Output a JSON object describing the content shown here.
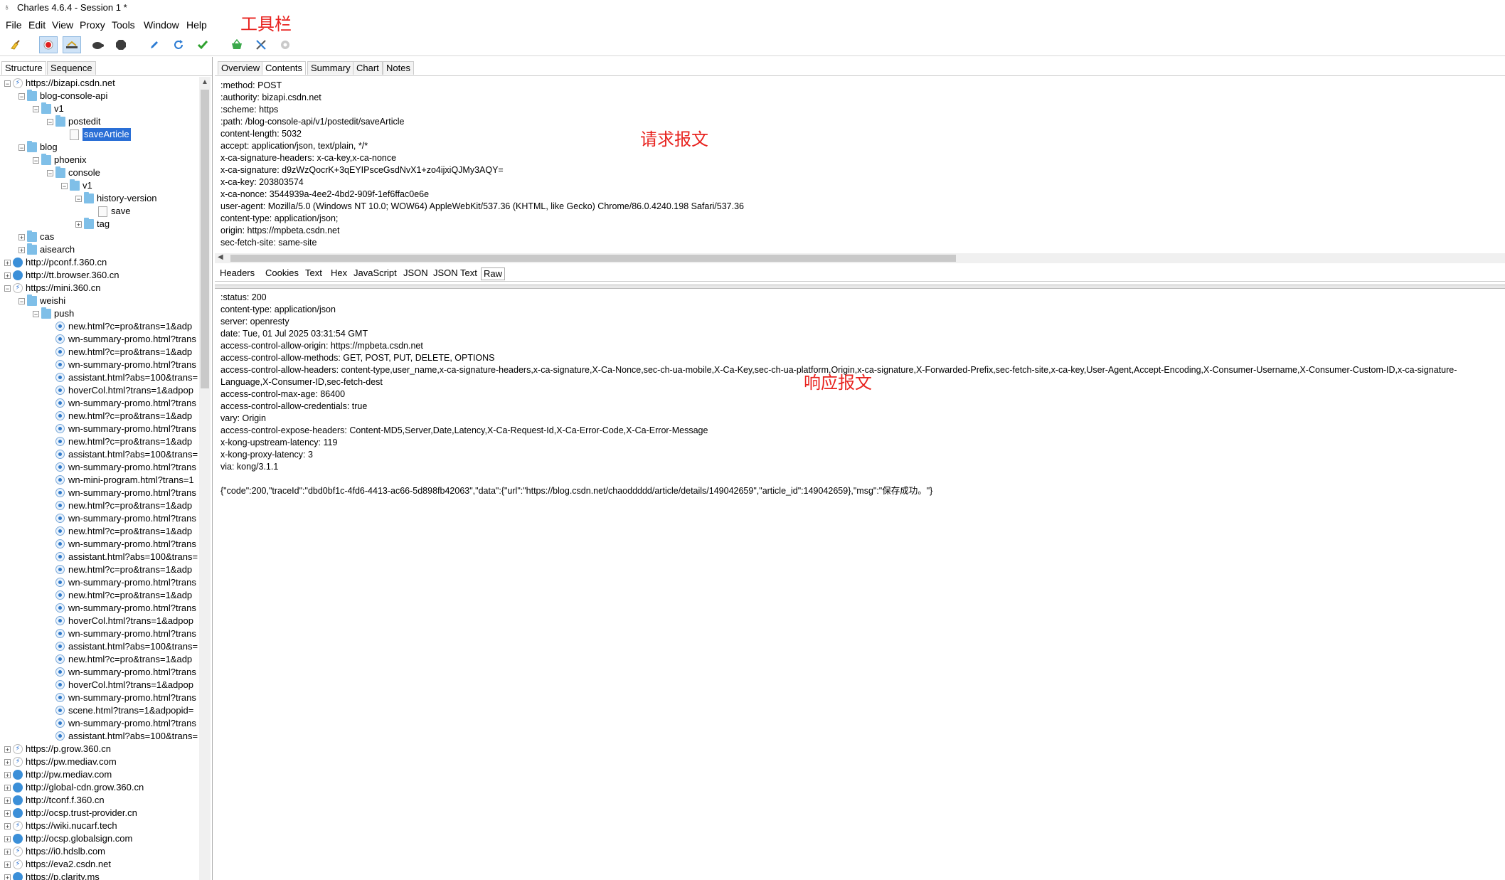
{
  "window": {
    "title": "Charles 4.6.4 - Session 1 *"
  },
  "menu": [
    "File",
    "Edit",
    "View",
    "Proxy",
    "Tools",
    "Window",
    "Help"
  ],
  "toolbar_annotation": "工具栏",
  "request_annotation": "请求报文",
  "response_annotation": "响应报文",
  "toolbar": {
    "icons": [
      "broom-icon",
      "record-icon",
      "throttle-icon",
      "turtle-icon",
      "stop-icon",
      "pen-icon",
      "refresh-icon",
      "check-icon",
      "basket-icon",
      "tools-icon",
      "settings-icon"
    ],
    "colors": {
      "record": "#e02020",
      "check": "#2fa12f",
      "basket": "#3aa84a",
      "refresh": "#2b7bd3"
    }
  },
  "left_tabs": [
    "Structure",
    "Sequence"
  ],
  "tree": [
    {
      "label": "https://bizapi.csdn.net",
      "icon": "lightning",
      "exp": "−",
      "level": 0
    },
    {
      "label": "blog-console-api",
      "icon": "folder",
      "exp": "−",
      "level": 1
    },
    {
      "label": "v1",
      "icon": "folder",
      "exp": "−",
      "level": 2
    },
    {
      "label": "postedit",
      "icon": "folder",
      "exp": "−",
      "level": 3
    },
    {
      "label": "saveArticle",
      "icon": "page",
      "exp": "",
      "level": 4,
      "selected": true
    },
    {
      "label": "blog",
      "icon": "folder",
      "exp": "−",
      "level": 1
    },
    {
      "label": "phoenix",
      "icon": "folder",
      "exp": "−",
      "level": 2
    },
    {
      "label": "console",
      "icon": "folder",
      "exp": "−",
      "level": 3
    },
    {
      "label": "v1",
      "icon": "folder",
      "exp": "−",
      "level": 4
    },
    {
      "label": "history-version",
      "icon": "folder",
      "exp": "−",
      "level": 5
    },
    {
      "label": "save",
      "icon": "page",
      "exp": "",
      "level": 6
    },
    {
      "label": "tag",
      "icon": "folder",
      "exp": "+",
      "level": 5
    },
    {
      "label": "cas",
      "icon": "folder",
      "exp": "+",
      "level": 1
    },
    {
      "label": "aisearch",
      "icon": "folder",
      "exp": "+",
      "level": 1
    },
    {
      "label": "http://pconf.f.360.cn",
      "icon": "globe",
      "exp": "+",
      "level": 0
    },
    {
      "label": "http://tt.browser.360.cn",
      "icon": "globe",
      "exp": "+",
      "level": 0
    },
    {
      "label": "https://mini.360.cn",
      "icon": "lightning",
      "exp": "−",
      "level": 0
    },
    {
      "label": "weishi",
      "icon": "folder",
      "exp": "−",
      "level": 1
    },
    {
      "label": "push",
      "icon": "folder",
      "exp": "−",
      "level": 2
    },
    {
      "label": "new.html?c=pro&trans=1&adp",
      "icon": "dot",
      "exp": "",
      "level": 3
    },
    {
      "label": "wn-summary-promo.html?trans",
      "icon": "dot",
      "exp": "",
      "level": 3
    },
    {
      "label": "new.html?c=pro&trans=1&adp",
      "icon": "dot",
      "exp": "",
      "level": 3
    },
    {
      "label": "wn-summary-promo.html?trans",
      "icon": "dot",
      "exp": "",
      "level": 3
    },
    {
      "label": "assistant.html?abs=100&trans=",
      "icon": "dot",
      "exp": "",
      "level": 3
    },
    {
      "label": "hoverCol.html?trans=1&adpop",
      "icon": "dot",
      "exp": "",
      "level": 3
    },
    {
      "label": "wn-summary-promo.html?trans",
      "icon": "dot",
      "exp": "",
      "level": 3
    },
    {
      "label": "new.html?c=pro&trans=1&adp",
      "icon": "dot",
      "exp": "",
      "level": 3
    },
    {
      "label": "wn-summary-promo.html?trans",
      "icon": "dot",
      "exp": "",
      "level": 3
    },
    {
      "label": "new.html?c=pro&trans=1&adp",
      "icon": "dot",
      "exp": "",
      "level": 3
    },
    {
      "label": "assistant.html?abs=100&trans=",
      "icon": "dot",
      "exp": "",
      "level": 3
    },
    {
      "label": "wn-summary-promo.html?trans",
      "icon": "dot",
      "exp": "",
      "level": 3
    },
    {
      "label": "wn-mini-program.html?trans=1",
      "icon": "dot",
      "exp": "",
      "level": 3
    },
    {
      "label": "wn-summary-promo.html?trans",
      "icon": "dot",
      "exp": "",
      "level": 3
    },
    {
      "label": "new.html?c=pro&trans=1&adp",
      "icon": "dot",
      "exp": "",
      "level": 3
    },
    {
      "label": "wn-summary-promo.html?trans",
      "icon": "dot",
      "exp": "",
      "level": 3
    },
    {
      "label": "new.html?c=pro&trans=1&adp",
      "icon": "dot",
      "exp": "",
      "level": 3
    },
    {
      "label": "wn-summary-promo.html?trans",
      "icon": "dot",
      "exp": "",
      "level": 3
    },
    {
      "label": "assistant.html?abs=100&trans=",
      "icon": "dot",
      "exp": "",
      "level": 3
    },
    {
      "label": "new.html?c=pro&trans=1&adp",
      "icon": "dot",
      "exp": "",
      "level": 3
    },
    {
      "label": "wn-summary-promo.html?trans",
      "icon": "dot",
      "exp": "",
      "level": 3
    },
    {
      "label": "new.html?c=pro&trans=1&adp",
      "icon": "dot",
      "exp": "",
      "level": 3
    },
    {
      "label": "wn-summary-promo.html?trans",
      "icon": "dot",
      "exp": "",
      "level": 3
    },
    {
      "label": "hoverCol.html?trans=1&adpop",
      "icon": "dot",
      "exp": "",
      "level": 3
    },
    {
      "label": "wn-summary-promo.html?trans",
      "icon": "dot",
      "exp": "",
      "level": 3
    },
    {
      "label": "assistant.html?abs=100&trans=",
      "icon": "dot",
      "exp": "",
      "level": 3
    },
    {
      "label": "new.html?c=pro&trans=1&adp",
      "icon": "dot",
      "exp": "",
      "level": 3
    },
    {
      "label": "wn-summary-promo.html?trans",
      "icon": "dot",
      "exp": "",
      "level": 3
    },
    {
      "label": "hoverCol.html?trans=1&adpop",
      "icon": "dot",
      "exp": "",
      "level": 3
    },
    {
      "label": "wn-summary-promo.html?trans",
      "icon": "dot",
      "exp": "",
      "level": 3
    },
    {
      "label": "scene.html?trans=1&adpopid=",
      "icon": "dot",
      "exp": "",
      "level": 3
    },
    {
      "label": "wn-summary-promo.html?trans",
      "icon": "dot",
      "exp": "",
      "level": 3
    },
    {
      "label": "assistant.html?abs=100&trans=",
      "icon": "dot",
      "exp": "",
      "level": 3
    },
    {
      "label": "https://p.grow.360.cn",
      "icon": "lightning",
      "exp": "+",
      "level": 0
    },
    {
      "label": "https://pw.mediav.com",
      "icon": "lightning",
      "exp": "+",
      "level": 0
    },
    {
      "label": "http://pw.mediav.com",
      "icon": "globe",
      "exp": "+",
      "level": 0
    },
    {
      "label": "http://global-cdn.grow.360.cn",
      "icon": "globe",
      "exp": "+",
      "level": 0
    },
    {
      "label": "http://tconf.f.360.cn",
      "icon": "globe",
      "exp": "+",
      "level": 0
    },
    {
      "label": "http://ocsp.trust-provider.cn",
      "icon": "globe",
      "exp": "+",
      "level": 0
    },
    {
      "label": "https://wiki.nucarf.tech",
      "icon": "lightning",
      "exp": "+",
      "level": 0
    },
    {
      "label": "http://ocsp.globalsign.com",
      "icon": "globe",
      "exp": "+",
      "level": 0
    },
    {
      "label": "https://i0.hdslb.com",
      "icon": "lightning",
      "exp": "+",
      "level": 0
    },
    {
      "label": "https://eva2.csdn.net",
      "icon": "lightning",
      "exp": "+",
      "level": 0
    },
    {
      "label": "https://p.clarity.ms",
      "icon": "globe",
      "exp": "+",
      "level": 0
    }
  ],
  "right_tabs": [
    "Overview",
    "Contents",
    "Summary",
    "Chart",
    "Notes"
  ],
  "right_tabs_selected": "Contents",
  "request_lines": [
    ":method: POST",
    ":authority: bizapi.csdn.net",
    ":scheme: https",
    ":path: /blog-console-api/v1/postedit/saveArticle",
    "content-length: 5032",
    "accept: application/json, text/plain, */*",
    "x-ca-signature-headers: x-ca-key,x-ca-nonce",
    "x-ca-signature: d9zWzQocrK+3qEYIPsceGsdNvX1+zo4ijxiQJMy3AQY=",
    "x-ca-key: 203803574",
    "x-ca-nonce: 3544939a-4ee2-4bd2-909f-1ef6ffac0e6e",
    "user-agent: Mozilla/5.0 (Windows NT 10.0; WOW64) AppleWebKit/537.36 (KHTML, like Gecko) Chrome/86.0.4240.198 Safari/537.36",
    "content-type: application/json;",
    "origin: https://mpbeta.csdn.net",
    "sec-fetch-site: same-site"
  ],
  "bottom_tabs": [
    "Headers",
    "Cookies",
    "Text",
    "Hex",
    "JavaScript",
    "JSON",
    "JSON Text",
    "Raw"
  ],
  "bottom_tabs_selected": "Raw",
  "response_lines": [
    ":status: 200",
    "content-type: application/json",
    "server: openresty",
    "date: Tue, 01 Jul 2025 03:31:54 GMT",
    "access-control-allow-origin: https://mpbeta.csdn.net",
    "access-control-allow-methods: GET, POST, PUT, DELETE, OPTIONS",
    "access-control-allow-headers: content-type,user_name,x-ca-signature-headers,x-ca-signature,X-Ca-Nonce,sec-ch-ua-mobile,X-Ca-Key,sec-ch-ua-platform,Origin,x-ca-signature,X-Forwarded-Prefix,sec-fetch-site,x-ca-key,User-Agent,Accept-Encoding,X-Consumer-Username,X-Consumer-Custom-ID,x-ca-signature-",
    "Language,X-Consumer-ID,sec-fetch-dest",
    "access-control-max-age: 86400",
    "access-control-allow-credentials: true",
    "vary: Origin",
    "access-control-expose-headers: Content-MD5,Server,Date,Latency,X-Ca-Request-Id,X-Ca-Error-Code,X-Ca-Error-Message",
    "x-kong-upstream-latency: 119",
    "x-kong-proxy-latency: 3",
    "via: kong/3.1.1"
  ],
  "response_body": "{\"code\":200,\"traceId\":\"dbd0bf1c-4fd6-4413-ac66-5d898fb42063\",\"data\":{\"url\":\"https://blog.csdn.net/chaoddddd/article/details/149042659\",\"article_id\":149042659},\"msg\":\"保存成功。\"}"
}
